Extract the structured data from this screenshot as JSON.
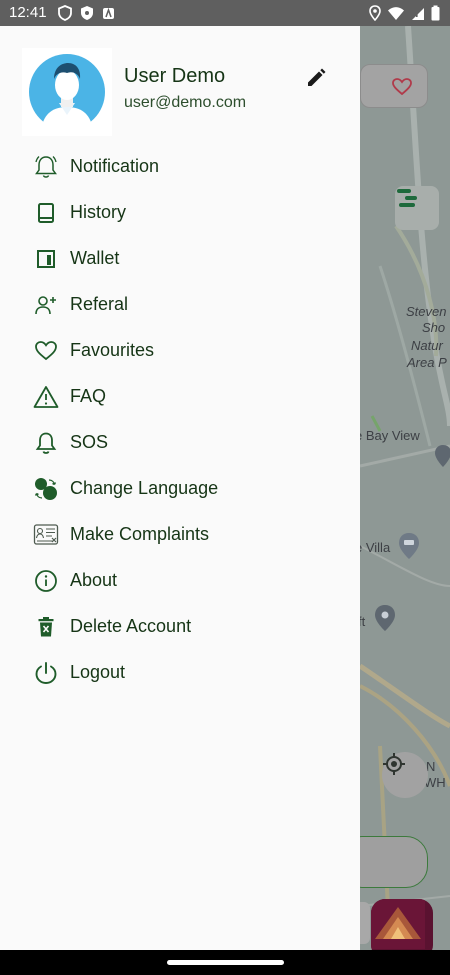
{
  "status_bar": {
    "time": "12:41",
    "left_icons": [
      "shield-icon",
      "vpn-icon",
      "app-notification-icon"
    ],
    "right_icons": [
      "location-icon",
      "wifi-icon",
      "signal-icon",
      "battery-icon"
    ]
  },
  "drawer": {
    "profile": {
      "name": "User Demo",
      "email": "user@demo.com"
    },
    "menu": [
      {
        "label": "Notification",
        "icon": "bell-outline-icon"
      },
      {
        "label": "History",
        "icon": "book-icon"
      },
      {
        "label": "Wallet",
        "icon": "wallet-icon"
      },
      {
        "label": "Referal",
        "icon": "add-user-icon"
      },
      {
        "label": "Favourites",
        "icon": "heart-icon"
      },
      {
        "label": "FAQ",
        "icon": "warning-icon"
      },
      {
        "label": "SOS",
        "icon": "bell-icon"
      },
      {
        "label": "Change Language",
        "icon": "language-icon"
      },
      {
        "label": "Make Complaints",
        "icon": "complaint-icon"
      },
      {
        "label": "About",
        "icon": "info-icon"
      },
      {
        "label": "Delete Account",
        "icon": "trash-icon"
      },
      {
        "label": "Logout",
        "icon": "power-icon"
      }
    ]
  },
  "map": {
    "labels": {
      "steven": "Steven",
      "sho": "Sho",
      "natur": "Natur",
      "area": "Area P",
      "bay_view": "e Bay View",
      "villa": "e Villa",
      "ft": "ft",
      "n": "N",
      "wh": "WH"
    }
  },
  "colors": {
    "accent": "#1f5c2a",
    "text": "#163516",
    "drawer_bg": "#fafafa",
    "scrim_map": "#8d9794"
  }
}
